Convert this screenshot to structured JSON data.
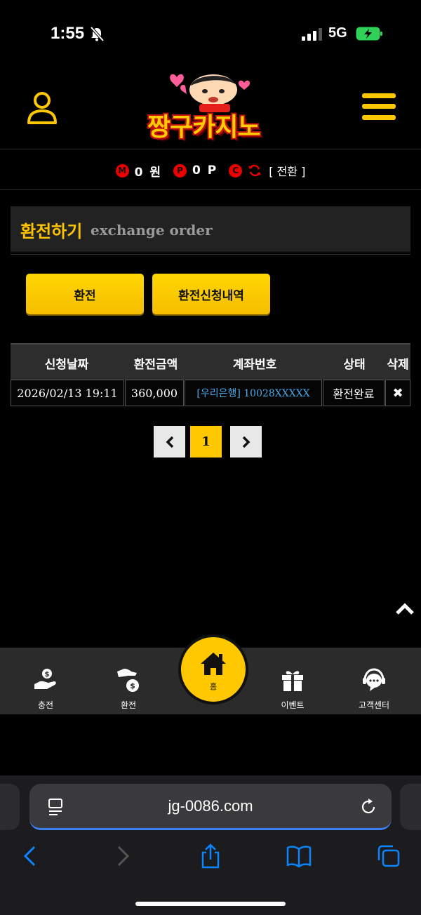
{
  "status_bar": {
    "time": "1:55",
    "network": "5G"
  },
  "header": {
    "logo_text": "짱구카지노"
  },
  "balance": {
    "money_badge": "M",
    "money": "0 원",
    "point_badge": "P",
    "point": "0 P",
    "casino_badge": "C",
    "switch_label": "[ 전환 ]"
  },
  "section": {
    "title_ko": "환전하기",
    "title_en": "exchange order"
  },
  "buttons": {
    "exchange": "환전",
    "history": "환전신청내역"
  },
  "table": {
    "headers": [
      "신청날짜",
      "환전금액",
      "계좌번호",
      "상태",
      "삭제"
    ],
    "rows": [
      {
        "date": "2026/02/13 19:11",
        "amount": "360,000",
        "account": "[우리은행] 10028XXXXX",
        "status": "환전완료",
        "delete": "✖"
      }
    ]
  },
  "pagination": {
    "current": "1"
  },
  "bottom_nav": {
    "deposit": "충전",
    "exchange": "환전",
    "home": "홈",
    "event": "이벤트",
    "support": "고객센터"
  },
  "browser": {
    "url": "jg-0086.com"
  },
  "colors": {
    "accent": "#ffc800",
    "link": "#4aa8e8",
    "badge": "#e00000"
  }
}
